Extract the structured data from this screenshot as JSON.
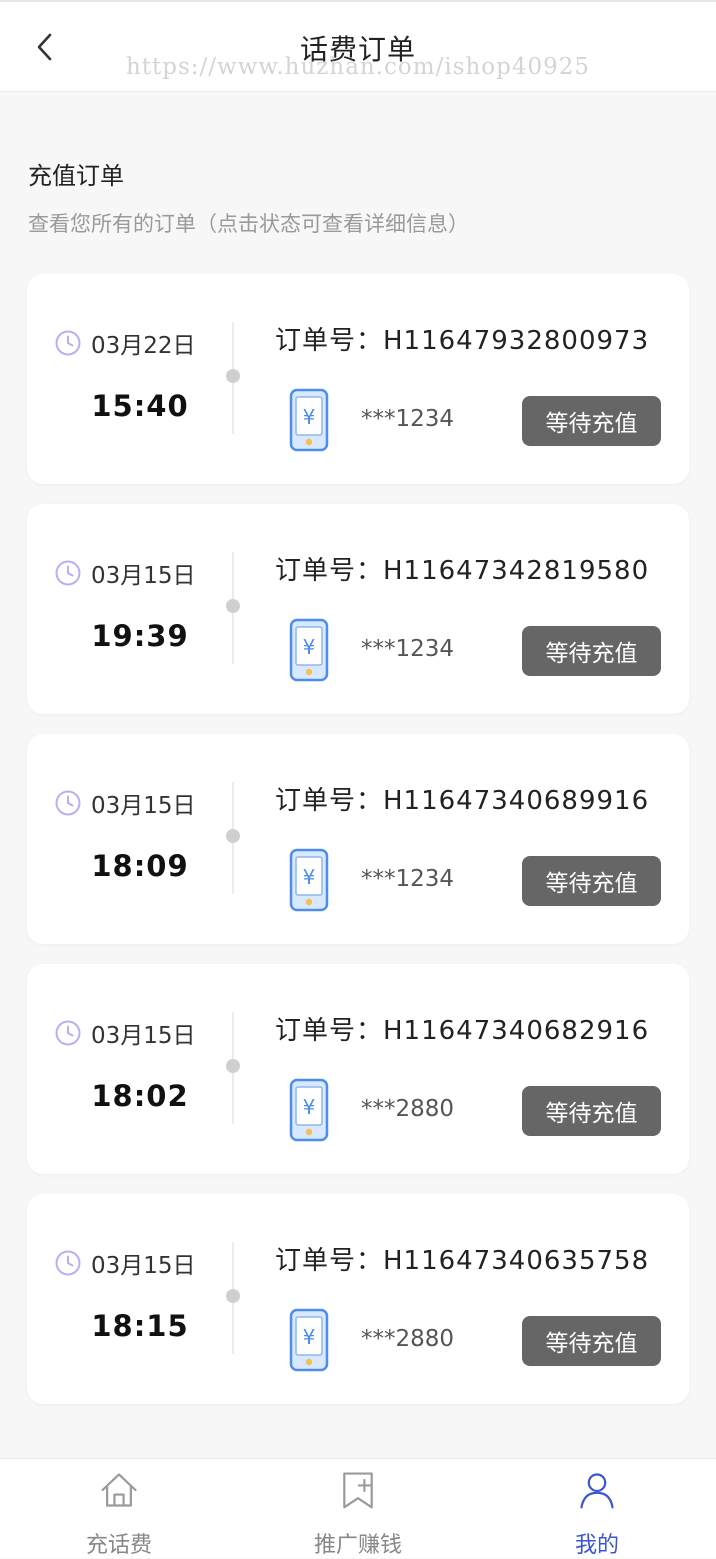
{
  "header": {
    "title": "话费订单",
    "watermark": "https://www.huzhan.com/ishop40925"
  },
  "section": {
    "title": "充值订单",
    "subtitle": "查看您所有的订单（点击状态可查看详细信息）"
  },
  "orders": [
    {
      "date": "03月22日",
      "time": "15:40",
      "order_no": "订单号：H11647932800973",
      "phone": "***1234",
      "status": "等待充值"
    },
    {
      "date": "03月15日",
      "time": "19:39",
      "order_no": "订单号：H11647342819580",
      "phone": "***1234",
      "status": "等待充值"
    },
    {
      "date": "03月15日",
      "time": "18:09",
      "order_no": "订单号：H11647340689916",
      "phone": "***1234",
      "status": "等待充值"
    },
    {
      "date": "03月15日",
      "time": "18:02",
      "order_no": "订单号：H11647340682916",
      "phone": "***2880",
      "status": "等待充值"
    },
    {
      "date": "03月15日",
      "time": "18:15",
      "order_no": "订单号：H11647340635758",
      "phone": "***2880",
      "status": "等待充值"
    }
  ],
  "tabbar": {
    "items": [
      {
        "label": "充话费",
        "icon": "home-icon",
        "active": false
      },
      {
        "label": "推广赚钱",
        "icon": "bookmark-plus-icon",
        "active": false
      },
      {
        "label": "我的",
        "icon": "user-icon",
        "active": true
      }
    ]
  },
  "colors": {
    "accent": "#3a56d4",
    "status_button": "#666666",
    "clock_icon": "#b8b0f0",
    "phone_icon_fill": "#d7e8ff",
    "phone_icon_stroke": "#4f8ee8",
    "phone_icon_dot": "#f2c14e"
  }
}
